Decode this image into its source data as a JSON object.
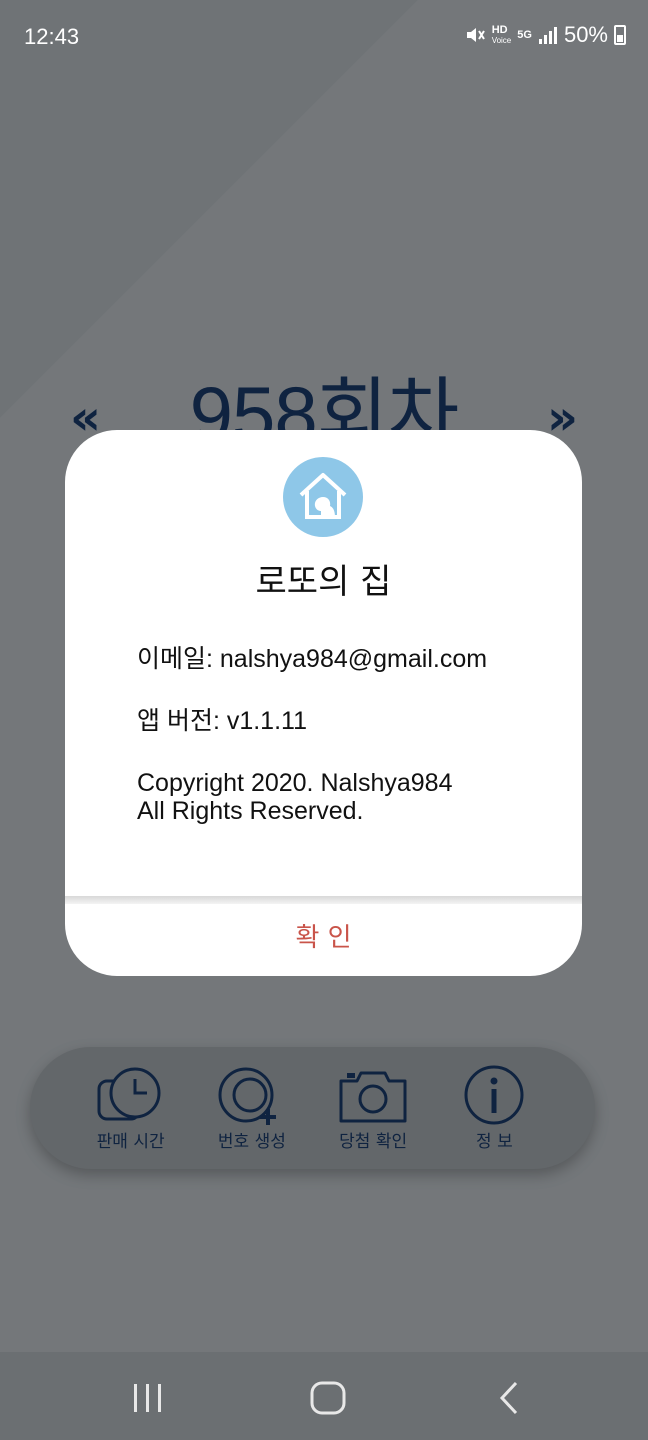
{
  "status_bar": {
    "time": "12:43",
    "hd_label": "HD",
    "voice_label": "Voice",
    "network_label": "5G",
    "battery_pct": "50%"
  },
  "header": {
    "round_title": "958회차",
    "prev_arrow": "«",
    "next_arrow": "»"
  },
  "bottom_nav": {
    "items": [
      {
        "label": "판매 시간",
        "icon": "clock-icon"
      },
      {
        "label": "번호 생성",
        "icon": "search-add-icon"
      },
      {
        "label": "당첨 확인",
        "icon": "camera-icon"
      },
      {
        "label": "정   보",
        "icon": "info-icon"
      }
    ]
  },
  "dialog": {
    "app_name": "로또의 집",
    "email_line": "이메일: nalshya984@gmail.com",
    "version_line": "앱 버전: v1.1.11",
    "copyright_line1": "Copyright 2020. Nalshya984",
    "copyright_line2": "All Rights Reserved.",
    "confirm_label": "확 인"
  },
  "colors": {
    "accent": "#0f2340",
    "confirm": "#c9544a",
    "icon_circle": "#8ec7e8"
  }
}
